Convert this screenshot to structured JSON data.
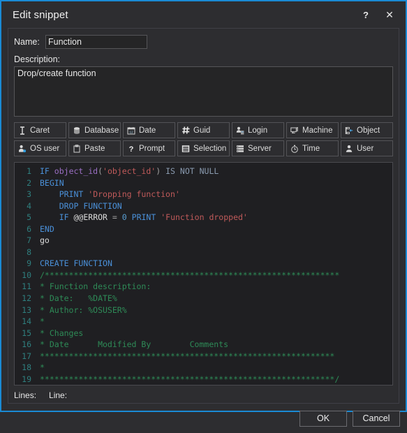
{
  "window": {
    "title": "Edit snippet",
    "help_label": "?",
    "close_label": "✕",
    "accent_color": "#1a8ad4",
    "background_color": "#2d2d30"
  },
  "form": {
    "name_label": "Name:",
    "name_value": "Function",
    "name_placeholder": "",
    "description_label": "Description:",
    "description_value": "Drop/create function",
    "description_placeholder": ""
  },
  "tokens": [
    {
      "label": "Caret",
      "icon": "caret-icon"
    },
    {
      "label": "Database",
      "icon": "database-icon"
    },
    {
      "label": "Date",
      "icon": "calendar-icon"
    },
    {
      "label": "Guid",
      "icon": "hash-icon"
    },
    {
      "label": "Login",
      "icon": "login-icon"
    },
    {
      "label": "Machine",
      "icon": "monitor-icon"
    },
    {
      "label": "Object",
      "icon": "object-icon"
    },
    {
      "label": "OS user",
      "icon": "os-user-icon"
    },
    {
      "label": "Paste",
      "icon": "clipboard-icon"
    },
    {
      "label": "Prompt",
      "icon": "question-icon"
    },
    {
      "label": "Selection",
      "icon": "selection-icon"
    },
    {
      "label": "Server",
      "icon": "server-icon"
    },
    {
      "label": "Time",
      "icon": "clock-icon"
    },
    {
      "label": "User",
      "icon": "user-icon"
    }
  ],
  "editor": {
    "line_numbers": [
      "1",
      "2",
      "3",
      "4",
      "5",
      "6",
      "7",
      "8",
      "9",
      "10",
      "11",
      "12",
      "13",
      "14",
      "15",
      "16",
      "17",
      "18",
      "19"
    ],
    "lines": [
      "IF object_id('object_id') IS NOT NULL",
      "BEGIN",
      "    PRINT 'Dropping function'",
      "    DROP FUNCTION",
      "    IF @@ERROR = 0 PRINT 'Function dropped'",
      "END",
      "go",
      "",
      "CREATE FUNCTION",
      "/*************************************************************",
      "* Function description:",
      "* Date:   %DATE%",
      "* Author: %OSUSER%",
      "*",
      "* Changes",
      "* Date      Modified By        Comments",
      "*************************************************************",
      "*",
      "*************************************************************/"
    ],
    "colors": {
      "background": "#1f1f22",
      "line_number": "#2f7f7f",
      "keyword": "#4a90d9",
      "keyword_gray": "#8a9bb0",
      "function": "#9b6fc4",
      "string": "#c05a5a",
      "comment": "#2e8b57",
      "default": "#d4d4d4"
    }
  },
  "status": {
    "lines_label": "Lines:",
    "lines_value": "",
    "line_label": "Line:",
    "line_value": ""
  },
  "footer": {
    "ok_label": "OK",
    "cancel_label": "Cancel"
  }
}
